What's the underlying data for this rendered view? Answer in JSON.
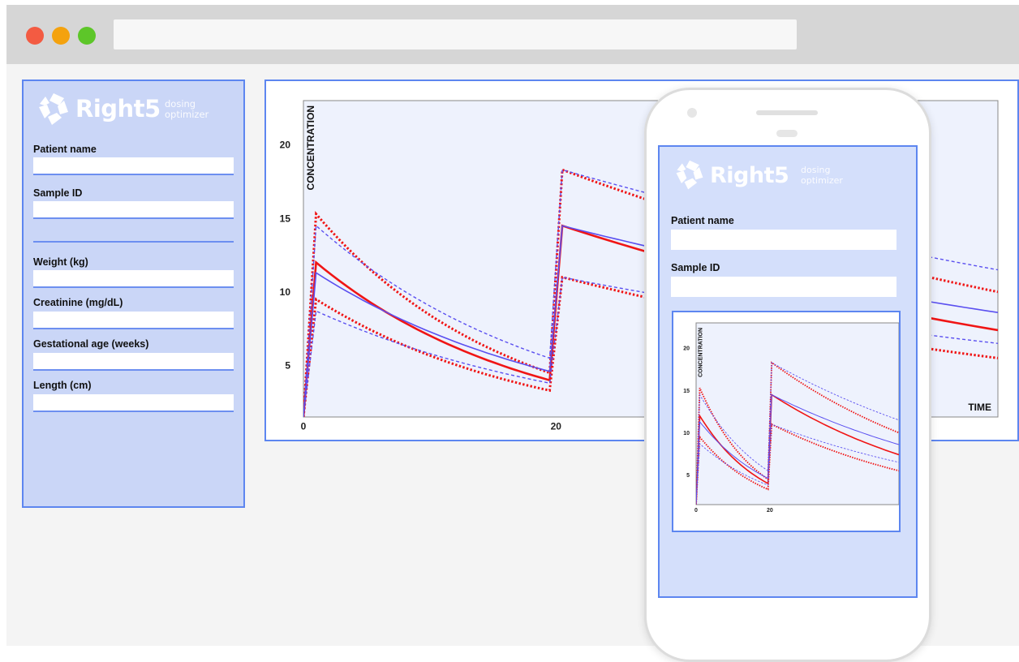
{
  "brand": {
    "name": "Right5",
    "tagline_line1": "dosing",
    "tagline_line2": "optimizer",
    "logo_color": "#ffffff"
  },
  "window": {
    "controls": [
      "close",
      "minimize",
      "maximize"
    ],
    "control_colors": [
      "#f35b42",
      "#f4a20e",
      "#5dc629"
    ],
    "address": ""
  },
  "form": {
    "patient_name_label": "Patient name",
    "patient_name_value": "",
    "sample_id_label": "Sample ID",
    "sample_id_value": "",
    "weight_label": "Weight (kg)",
    "weight_value": "",
    "creatinine_label": "Creatinine (mg/dL)",
    "creatinine_value": "",
    "gestational_label": "Gestational age (weeks)",
    "gestational_value": "",
    "length_label": "Length (cm)",
    "length_value": ""
  },
  "colors": {
    "panel_fill": "#cad6f7",
    "panel_border": "#5d86f0",
    "plot_fill": "#eef2fd",
    "series_red": "#f01515",
    "series_blue": "#5a4ff0"
  },
  "chart_data": {
    "type": "line",
    "ylabel": "CONCENTRATION",
    "xlabel": "TIME",
    "x_ticks": [
      0,
      20
    ],
    "y_ticks": [
      5,
      10,
      15,
      20
    ],
    "xlim": [
      0,
      55
    ],
    "ylim": [
      1.5,
      23
    ],
    "grid": false,
    "dose_times": [
      0,
      19.5
    ],
    "infusion_duration": 1,
    "series": [
      {
        "color": "red",
        "style": "solid",
        "peaks": [
          12.0,
          14.5
        ],
        "troughs": [
          4.0
        ],
        "end": 7.4
      },
      {
        "color": "red",
        "style": "dotted",
        "peaks": [
          15.3,
          18.3
        ],
        "troughs": [
          4.5
        ],
        "end": 10.0
      },
      {
        "color": "red",
        "style": "dotted",
        "peaks": [
          9.5,
          11.0
        ],
        "troughs": [
          3.3
        ],
        "end": 5.5
      },
      {
        "color": "blue",
        "style": "solid",
        "peaks": [
          11.3,
          14.5
        ],
        "troughs": [
          4.6
        ],
        "end": 8.6
      },
      {
        "color": "blue",
        "style": "dashed",
        "peaks": [
          14.5,
          18.3
        ],
        "troughs": [
          5.5
        ],
        "end": 11.5
      },
      {
        "color": "blue",
        "style": "dashed",
        "peaks": [
          8.7,
          11.0
        ],
        "troughs": [
          3.8
        ],
        "end": 6.5
      }
    ]
  }
}
